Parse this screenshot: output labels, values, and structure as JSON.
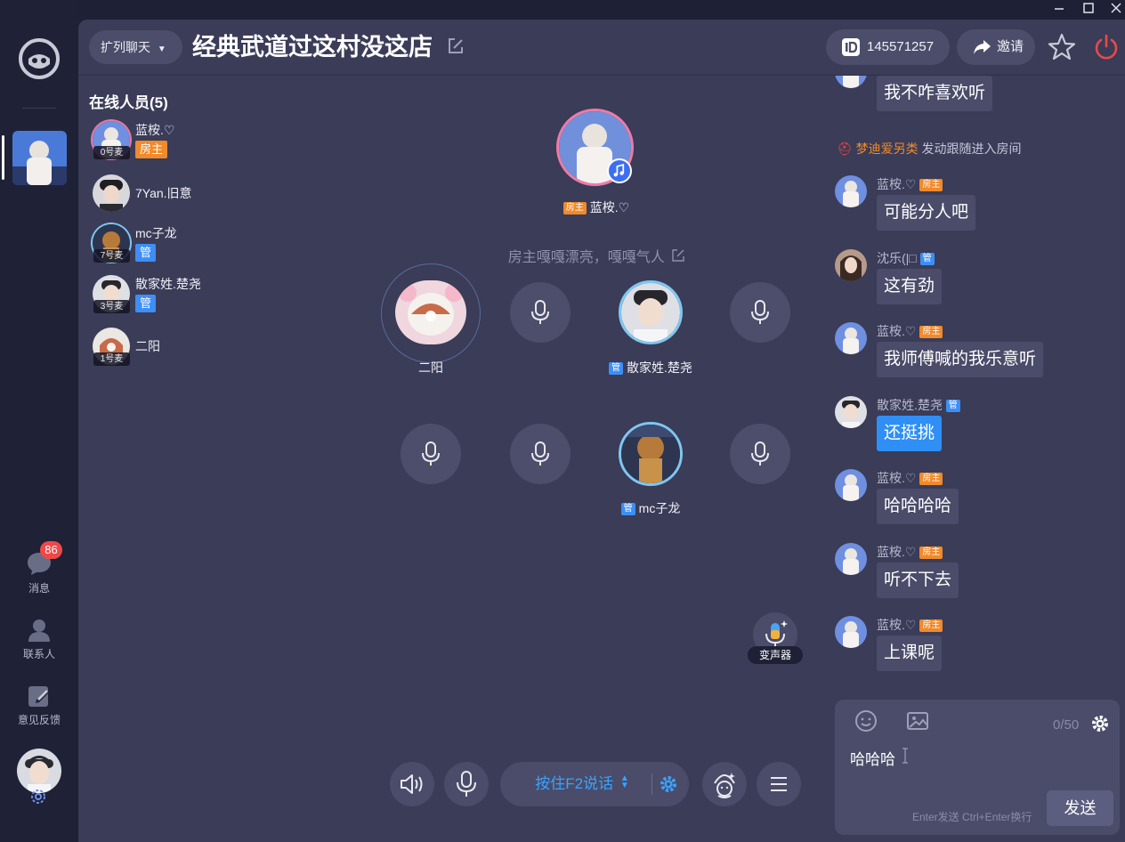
{
  "window": {
    "minimize_icon": "minimize-icon",
    "maximize_icon": "maximize-icon",
    "close_icon": "close-icon"
  },
  "sidebar": {
    "messages_label": "消息",
    "messages_badge": "86",
    "contacts_label": "联系人",
    "feedback_label": "意见反馈"
  },
  "header": {
    "expand_label": "扩列聊天",
    "room_title": "经典武道过这村没这店",
    "room_id": "145571257",
    "invite_label": "邀请"
  },
  "online": {
    "title": "在线人员(5)",
    "members": [
      {
        "name": "蓝桉.♡",
        "mic": "0号麦",
        "tag": "房主"
      },
      {
        "name": "7Yan.旧意",
        "mic": "",
        "tag": ""
      },
      {
        "name": "mc子龙",
        "mic": "7号麦",
        "tag": "管"
      },
      {
        "name": "散家姓.楚尧",
        "mic": "3号麦",
        "tag": "管"
      },
      {
        "name": "二阳",
        "mic": "1号麦",
        "tag": ""
      }
    ]
  },
  "stage": {
    "host_tag": "房主",
    "host_name": "蓝桉.♡",
    "announcement": "房主嘎嘎漂亮，嘎嘎气人",
    "seats": [
      {
        "name": "二阳",
        "tag": ""
      },
      {
        "name": "散家姓.楚尧",
        "tag": "管"
      },
      {
        "name": "mc子龙",
        "tag": "管"
      }
    ],
    "voice_changer_label": "变声器"
  },
  "controls": {
    "talk_label": "按住F2说话"
  },
  "chat": {
    "partial_message": "我不咋喜欢听",
    "follow_notice_user": "梦迪爱另类",
    "follow_notice_text": " 发动跟随进入房间",
    "messages": [
      {
        "user": "蓝桉.♡",
        "tag": "房主",
        "text": "可能分人吧"
      },
      {
        "user": "沈乐(|□",
        "tag": "管",
        "text": "这有劲"
      },
      {
        "user": "蓝桉.♡",
        "tag": "房主",
        "text": "我师傅喊的我乐意听"
      },
      {
        "user": "散家姓.楚尧",
        "tag": "管",
        "text": "还挺挑"
      },
      {
        "user": "蓝桉.♡",
        "tag": "房主",
        "text": "哈哈哈哈"
      },
      {
        "user": "蓝桉.♡",
        "tag": "房主",
        "text": "听不下去"
      },
      {
        "user": "蓝桉.♡",
        "tag": "房主",
        "text": "上课呢"
      }
    ],
    "input_value": "哈哈哈",
    "char_count": "0/50",
    "send_hint": "Enter发送 Ctrl+Enter换行",
    "send_label": "发送"
  },
  "colors": {
    "accent_blue": "#3aa3ff",
    "owner_orange": "#f08a2a",
    "admin_blue": "#3d8ef6",
    "badge_red": "#f04848"
  }
}
